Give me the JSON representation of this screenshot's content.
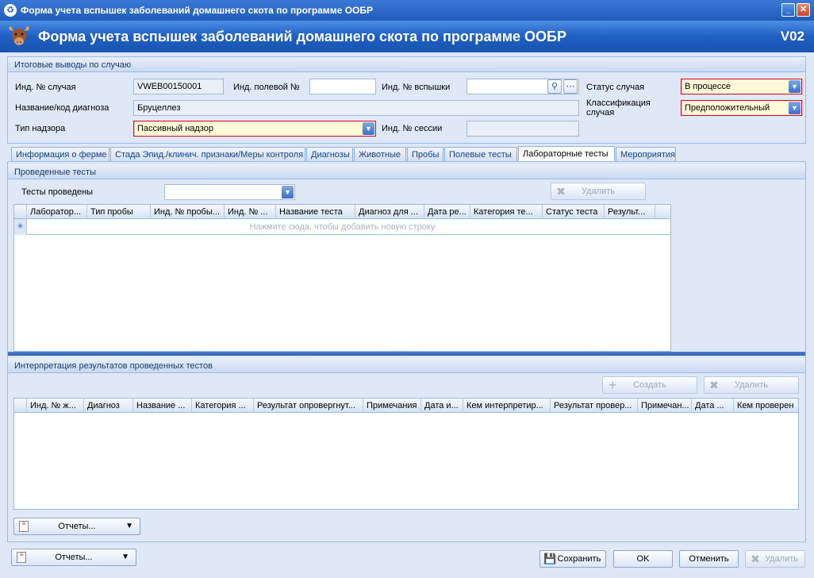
{
  "window": {
    "title": "Форма учета вспышек заболеваний домашнего скота по программе ООБР"
  },
  "header": {
    "title": "Форма учета вспышек заболеваний домашнего скота по программе ООБР",
    "version": "V02"
  },
  "summary": {
    "section_title": "Итоговые выводы по случаю",
    "case_id_label": "Инд. № случая",
    "case_id_value": "VWEB00150001",
    "field_id_label": "Инд. полевой №",
    "field_id_value": "",
    "outbreak_id_label": "Инд. № вспышки",
    "outbreak_id_value": "",
    "case_status_label": "Статус случая",
    "case_status_value": "В процессе",
    "diagnosis_label": "Название/код диагноза",
    "diagnosis_value": "Бруцеллез",
    "classification_label": "Классификация случая",
    "classification_value": "Предположительный",
    "surveillance_label": "Тип надзора",
    "surveillance_value": "Пассивный надзор",
    "session_id_label": "Инд. № сессии",
    "session_id_value": ""
  },
  "tabs": [
    "Информация о ферме",
    "Стада Эпид./клинич. признаки/Меры контроля",
    "Диагнозы",
    "Животные",
    "Пробы",
    "Полевые тесты",
    "Лабораторные тесты",
    "Мероприятия"
  ],
  "tests": {
    "section_title": "Проведенные тесты",
    "done_label": "Тесты проведены",
    "delete_label": "Удалить",
    "columns": [
      "Лаборатор...",
      "Тип пробы",
      "Инд. № пробы...",
      "Инд. № ...",
      "Название теста",
      "Диагноз для ...",
      "Дата ре...",
      "Категория те...",
      "Статус теста",
      "Результ..."
    ],
    "add_row_hint": "Нажмите сюда, чтобы добавить новую строку"
  },
  "interp": {
    "section_title": "Интерпретация результатов проведенных тестов",
    "create_label": "Создать",
    "delete_label": "Удалить",
    "columns": [
      "Инд. № ж...",
      "Диагноз",
      "Название ...",
      "Категория ...",
      "Результат опровергнут...",
      "Примечания",
      "Дата и...",
      "Кем интерпретир...",
      "Результат провер...",
      "Примечан...",
      "Дата ...",
      "Кем проверен"
    ],
    "reports_label": "Отчеты..."
  },
  "footer": {
    "reports_label": "Отчеты...",
    "save_label": "Сохранить",
    "ok_label": "OK",
    "cancel_label": "Отменить",
    "delete_label": "Удалить"
  }
}
